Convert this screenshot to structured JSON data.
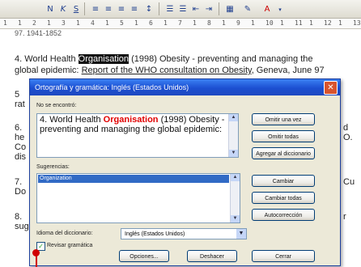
{
  "ruler": {
    "marks": [
      "1",
      "1",
      "2",
      "1",
      "3",
      "1",
      "4",
      "1",
      "5",
      "1",
      "6",
      "1",
      "7",
      "1",
      "8",
      "1",
      "9",
      "1",
      "10",
      "1",
      "11",
      "1",
      "12",
      "1",
      "13"
    ]
  },
  "document": {
    "line_top": "97. 1941-1852",
    "line1_a": "4. World Health ",
    "line1_hl": "Organisation",
    "line1_b": " (1998) Obesity - preventing and managing the",
    "line2_a": "global epidemic: ",
    "line2_ul": "Report of the WHO consultation on Obesity",
    "line2_b": ", Geneva, June 97",
    "frag_5": "5",
    "frag_rat": "rat",
    "frag_6": "6.",
    "frag_he": "he",
    "frag_co": "Co",
    "frag_dis": "dis",
    "frag_7": "7.",
    "frag_do": "Do",
    "frag_8": "8.",
    "frag_sug": "sug",
    "frag_d": "d",
    "frag_o": "O.",
    "frag_cu": "Cu",
    "frag_r": "r"
  },
  "dialog": {
    "title": "Ortografía y gramática: Inglés (Estados Unidos)",
    "not_found_label": "No se encontró:",
    "text_before": "4. World Health ",
    "text_error": "Organisation",
    "text_after": " (1998) Obesity - preventing and managing the global epidemic:",
    "suggestions_label": "Sugerencias:",
    "suggestions": [
      "Organization"
    ],
    "dictionary_label": "Idioma del diccionario:",
    "dictionary_value": "Inglés (Estados Unidos)",
    "grammar_check_label": "Revisar gramática",
    "grammar_checked": true,
    "buttons": {
      "ignore_once": "Omitir una vez",
      "ignore_all": "Omitir todas",
      "add_dict": "Agregar al diccionario",
      "change": "Cambiar",
      "change_all": "Cambiar todas",
      "autocorrect": "Autocorrección",
      "options": "Opciones...",
      "undo": "Deshacer",
      "cancel": "Cerrar"
    },
    "colors": {
      "title_blue": "#1c4fd1",
      "error_red": "#e10000",
      "selection": "#316ac5"
    }
  }
}
